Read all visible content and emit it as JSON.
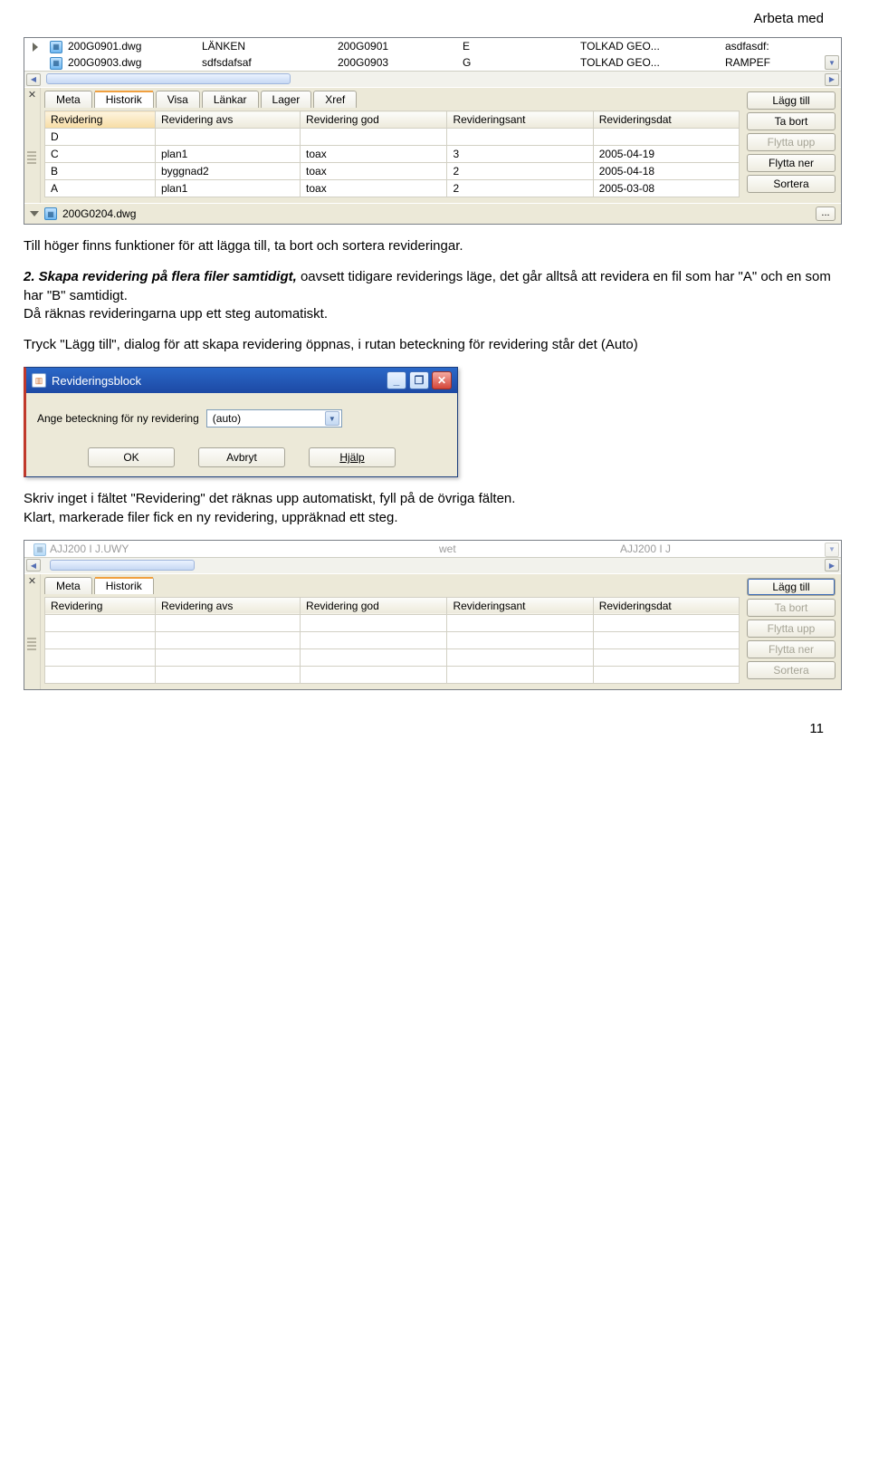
{
  "header": {
    "title": "Arbeta med"
  },
  "shot1": {
    "files": {
      "rows": [
        {
          "name": "200G0901.dwg",
          "c2": "LÄNKEN",
          "c3": "200G0901",
          "c4": "E",
          "c5": "TOLKAD GEO...",
          "c6": "asdfasdf:"
        },
        {
          "name": "200G0903.dwg",
          "c2": "sdfsdafsaf",
          "c3": "200G0903",
          "c4": "G",
          "c5": "TOLKAD GEO...",
          "c6": "RAMPEF"
        }
      ]
    },
    "tabs": [
      "Meta",
      "Historik",
      "Visa",
      "Länkar",
      "Lager",
      "Xref"
    ],
    "activeTab": "Historik",
    "columns": [
      "Revidering",
      "Revidering avs",
      "Revidering god",
      "Revideringsant",
      "Revideringsdat"
    ],
    "rows": [
      {
        "rev": "D",
        "avs": "",
        "god": "",
        "ant": "",
        "dat": ""
      },
      {
        "rev": "C",
        "avs": "plan1",
        "god": "toax",
        "ant": "3",
        "dat": "2005-04-19"
      },
      {
        "rev": "B",
        "avs": "byggnad2",
        "god": "toax",
        "ant": "2",
        "dat": "2005-04-18"
      },
      {
        "rev": "A",
        "avs": "plan1",
        "god": "toax",
        "ant": "2",
        "dat": "2005-03-08"
      }
    ],
    "buttons": {
      "add": "Lägg till",
      "remove": "Ta bort",
      "moveUp": "Flytta upp",
      "moveDown": "Flytta ner",
      "sort": "Sortera"
    },
    "status_file": "200G0204.dwg"
  },
  "text": {
    "p1": "Till höger finns funktioner för att lägga till, ta bort och sortera revideringar.",
    "p2_lead": "2. Skapa revidering på flera filer samtidigt,",
    "p2_rest": " oavsett tidigare reviderings läge, det går alltså att revidera en fil som har \"A\" och en som har \"B\" samtidigt.",
    "p2_line2": "Då räknas revideringarna upp ett steg automatiskt.",
    "p3": "Tryck \"Lägg till\", dialog för att skapa revidering öppnas, i rutan beteckning för revidering står det (Auto)",
    "p4": "Skriv inget i fältet \"Revidering\" det räknas upp automatiskt, fyll på de övriga fälten.",
    "p5": "Klart, markerade filer fick en ny revidering, uppräknad ett steg."
  },
  "dialog": {
    "title": "Revideringsblock",
    "label": "Ange beteckning för ny revidering",
    "value": "(auto)",
    "ok": "OK",
    "cancel": "Avbryt",
    "help": "Hjälp"
  },
  "shot2": {
    "topfile": "AJJ200 I J.UWY",
    "mid": "wet",
    "code": "AJJ200 I J",
    "tabs": [
      "Meta",
      "Historik"
    ],
    "activeTab": "Historik",
    "columns": [
      "Revidering",
      "Revidering avs",
      "Revidering god",
      "Revideringsant",
      "Revideringsdat"
    ],
    "buttons": {
      "add": "Lägg till",
      "remove": "Ta bort",
      "moveUp": "Flytta upp",
      "moveDown": "Flytta ner",
      "sort": "Sortera"
    }
  },
  "page_number": "11"
}
